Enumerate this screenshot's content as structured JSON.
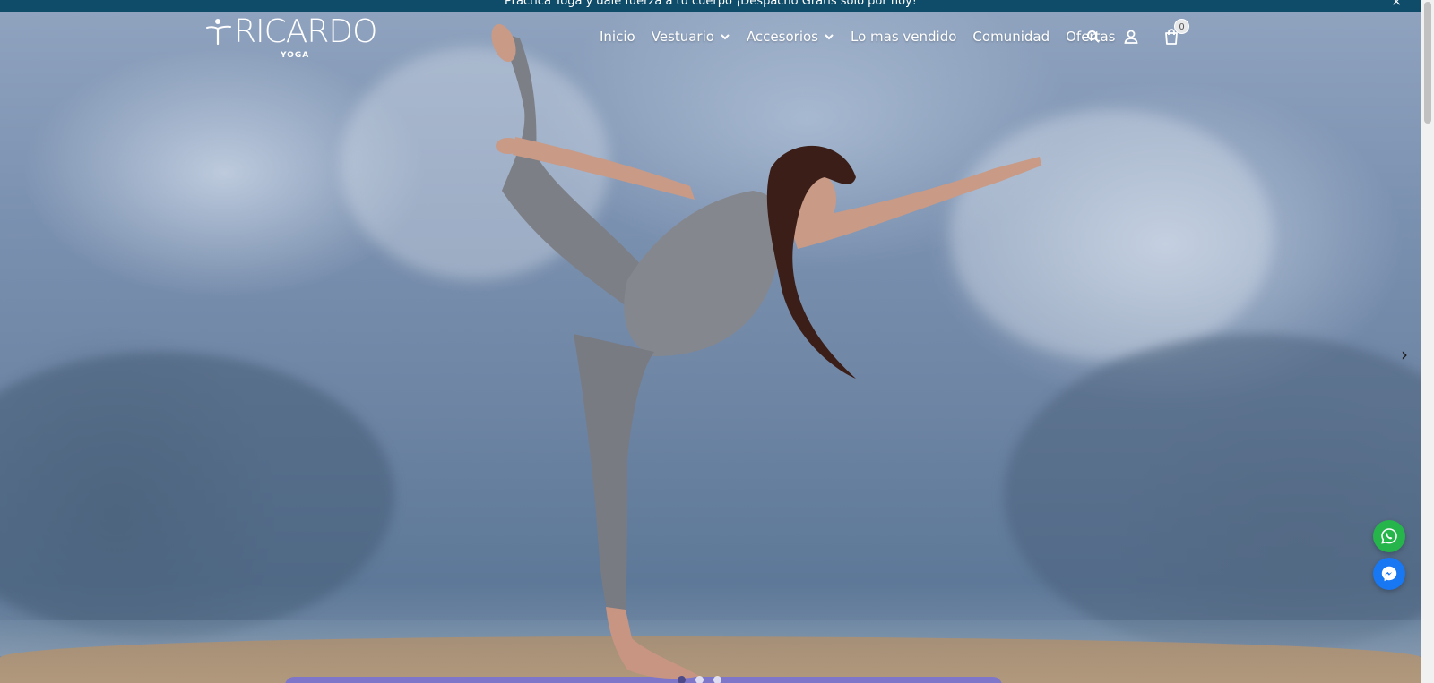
{
  "announcement": {
    "text": "Practica Yoga y dale fuerza a tu cuerpo ¡Despacho Gratis solo por hoy!",
    "close_label": "×"
  },
  "brand": {
    "name": "RICARDO",
    "subtitle": "YOGA"
  },
  "nav": {
    "items": [
      {
        "label": "Inicio",
        "has_dropdown": false
      },
      {
        "label": "Vestuario",
        "has_dropdown": true
      },
      {
        "label": "Accesorios",
        "has_dropdown": true
      },
      {
        "label": "Lo mas vendido",
        "has_dropdown": false
      },
      {
        "label": "Comunidad",
        "has_dropdown": false
      },
      {
        "label": "Ofertas",
        "has_dropdown": false
      }
    ]
  },
  "header_icons": {
    "search": "search-icon",
    "account": "user-icon",
    "cart": "shopping-bag-icon",
    "cart_count": "0"
  },
  "slider": {
    "next_arrow": "›",
    "slide_count": 3,
    "active_slide": 1
  },
  "floating_buttons": [
    {
      "name": "whatsapp",
      "icon": "whatsapp-icon",
      "color": "#25b54b"
    },
    {
      "name": "messenger",
      "icon": "messenger-icon",
      "color": "#1877f2"
    }
  ],
  "colors": {
    "announcement_bg": "#0f4c6a",
    "nav_text": "#ffffff",
    "mat": "#7e77c9"
  }
}
